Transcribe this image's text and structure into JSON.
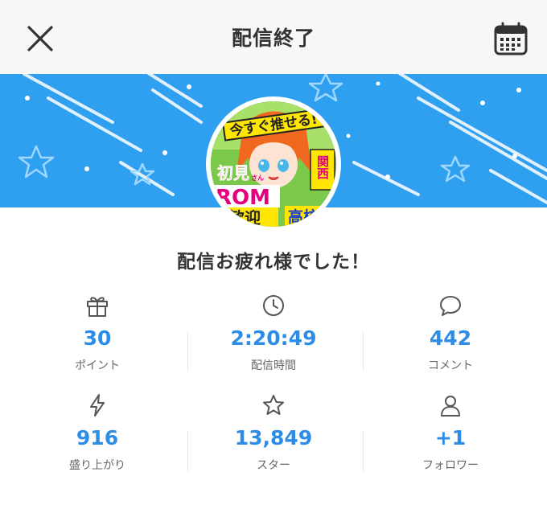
{
  "header": {
    "title": "配信終了",
    "close_icon": "close-icon",
    "calendar_icon": "calendar-icon"
  },
  "banner": {
    "color": "#2f9ff0"
  },
  "avatar": {
    "image_text": {
      "line1": "今すぐ推せる!",
      "line2": "初見",
      "line2_small": "さん",
      "line3": "ROM",
      "line4": "歓迎",
      "side_top": "関西",
      "side_bottom": "高校"
    }
  },
  "message": "配信お疲れ様でした！",
  "stats": [
    {
      "icon": "gift-icon",
      "value": "30",
      "label": "ポイント"
    },
    {
      "icon": "clock-icon",
      "value": "2:20:49",
      "label": "配信時間"
    },
    {
      "icon": "comment-icon",
      "value": "442",
      "label": "コメント"
    },
    {
      "icon": "lightning-icon",
      "value": "916",
      "label": "盛り上がり"
    },
    {
      "icon": "star-icon",
      "value": "13,849",
      "label": "スター"
    },
    {
      "icon": "user-icon",
      "value": "+1",
      "label": "フォロワー"
    }
  ],
  "colors": {
    "accent": "#2d8de6",
    "banner": "#2f9ff0",
    "text": "#333333",
    "label": "#666666"
  }
}
